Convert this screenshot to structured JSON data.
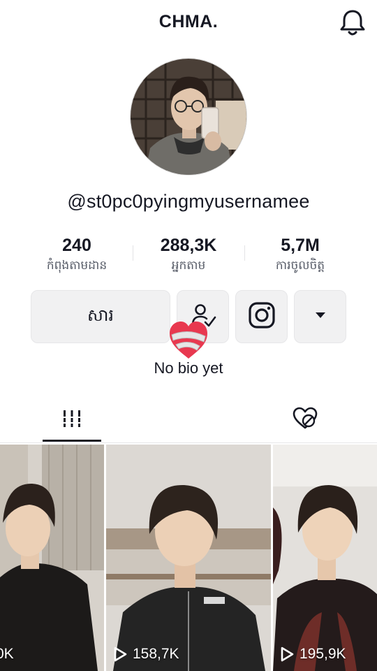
{
  "header": {
    "title": "CHMA.",
    "notification_icon": "bell-icon"
  },
  "profile": {
    "username": "@st0pc0pyingmyusernamee",
    "bio": "No bio yet"
  },
  "stats": [
    {
      "value": "240",
      "label": "កំពុងតាមដាន"
    },
    {
      "value": "288,3K",
      "label": "អ្នកតាម"
    },
    {
      "value": "5,7M",
      "label": "ការចូលចិត្ត"
    }
  ],
  "actions": {
    "message_label": "សារ",
    "follow_icon": "user-check-icon",
    "instagram_icon": "instagram-icon",
    "more_icon": "caret-down-icon"
  },
  "tabs": [
    {
      "name": "videos",
      "icon": "grid-icon",
      "active": true
    },
    {
      "name": "liked",
      "icon": "liked-hidden-icon",
      "active": false
    }
  ],
  "videos": [
    {
      "views": "0K"
    },
    {
      "views": "158,7K"
    },
    {
      "views": "195,9K"
    }
  ],
  "colors": {
    "text": "#161823",
    "secondary_text": "#555a66",
    "button_bg": "#f1f1f2",
    "heart": "#e8384f"
  }
}
